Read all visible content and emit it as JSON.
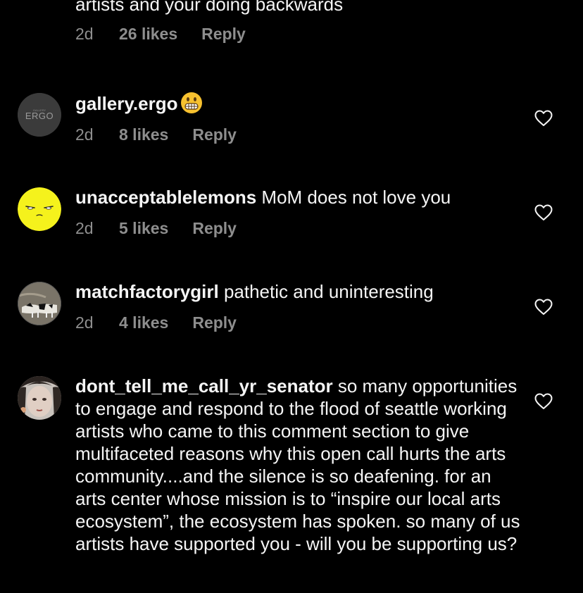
{
  "partial_comment": {
    "text": "artists and your doing backwards",
    "time": "2d",
    "likes": "26 likes",
    "reply": "Reply"
  },
  "comments": [
    {
      "username": "gallery.ergo",
      "text": "",
      "emoji": "grimacing-face-emoji",
      "time": "2d",
      "likes": "8 likes",
      "reply": "Reply",
      "avatar_text": "ERGO",
      "avatar_small_text": "GALLERY"
    },
    {
      "username": "unacceptablelemons",
      "text": " MoM does not love you",
      "time": "2d",
      "likes": "5 likes",
      "reply": "Reply"
    },
    {
      "username": "matchfactorygirl",
      "text": " pathetic and uninteresting",
      "time": "2d",
      "likes": "4 likes",
      "reply": "Reply"
    },
    {
      "username": "dont_tell_me_call_yr_senator",
      "text": " so many opportunities to engage and respond to the flood of seattle working artists who came to this comment section to give multifaceted reasons why this open call hurts the arts community....and the silence is so deafening. for an arts center whose mission is to “inspire our local arts ecosystem”, the ecosystem has spoken. so many of us artists have supported you - will you be supporting us?"
    }
  ],
  "colors": {
    "background": "#000000",
    "primary_text": "#f5f5f5",
    "secondary_text": "#8e8e8e",
    "lemon_yellow": "#f5f21c"
  }
}
